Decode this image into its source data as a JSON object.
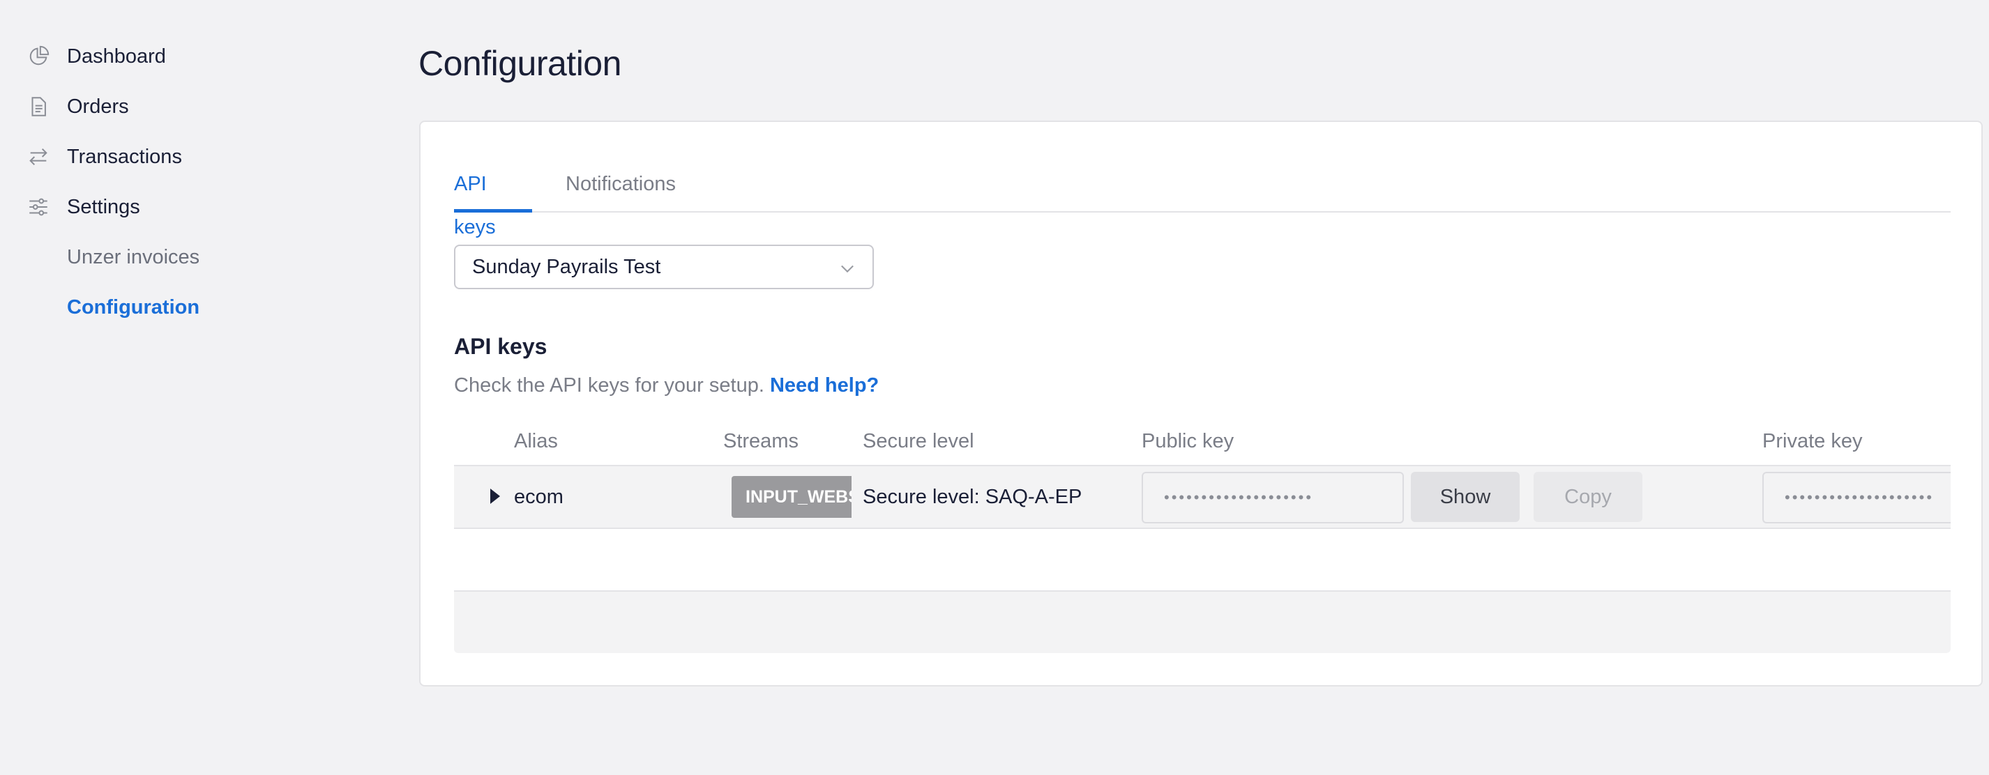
{
  "sidebar": {
    "items": [
      {
        "label": "Dashboard",
        "icon": "pie-chart-icon"
      },
      {
        "label": "Orders",
        "icon": "document-icon"
      },
      {
        "label": "Transactions",
        "icon": "arrows-exchange-icon"
      },
      {
        "label": "Settings",
        "icon": "sliders-icon"
      }
    ],
    "subitems": [
      {
        "label": "Unzer invoices",
        "active": false
      },
      {
        "label": "Configuration",
        "active": true
      }
    ]
  },
  "page": {
    "title": "Configuration"
  },
  "tabs": [
    {
      "label": "API keys",
      "active": true
    },
    {
      "label": "Notifications",
      "active": false
    }
  ],
  "merchant_select": {
    "value": "Sunday Payrails Test"
  },
  "api_keys": {
    "title": "API keys",
    "description": "Check the API keys for your setup.",
    "help_link": "Need help?",
    "columns": [
      "Alias",
      "Streams",
      "Secure level",
      "Public key",
      "Private key"
    ],
    "rows": [
      {
        "alias": "ecom",
        "stream": "INPUT_WEBS",
        "secure_level": "Secure level: SAQ-A-EP",
        "public_key_masked": "••••••••••••••••••••",
        "private_key_masked": "••••••••••••••••••••",
        "show_label": "Show",
        "copy_label": "Copy"
      }
    ]
  },
  "colors": {
    "accent": "#1a6ed8",
    "background": "#f2f2f4",
    "badge": "#9a9a9d"
  }
}
